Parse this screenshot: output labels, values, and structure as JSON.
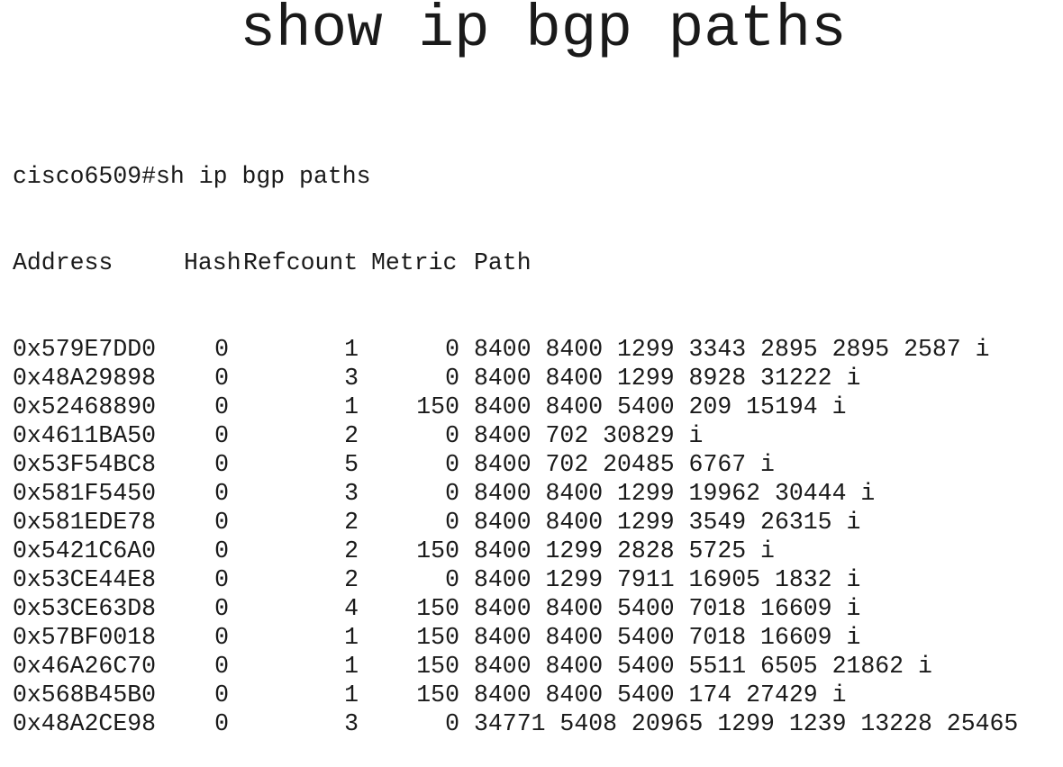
{
  "title": "show ip bgp paths",
  "terminal": {
    "prompt": "cisco6509#sh ip bgp paths",
    "headers": {
      "address": "Address",
      "hash": "Hash",
      "refcount": "Refcount",
      "metric": "Metric",
      "path": "Path"
    },
    "rows": [
      {
        "address": "0x579E7DD0",
        "hash": "0",
        "refcount": "1",
        "metric": "0",
        "path": "8400 8400 1299 3343 2895 2895 2587 i"
      },
      {
        "address": "0x48A29898",
        "hash": "0",
        "refcount": "3",
        "metric": "0",
        "path": "8400 8400 1299 8928 31222 i"
      },
      {
        "address": "0x52468890",
        "hash": "0",
        "refcount": "1",
        "metric": "150",
        "path": "8400 8400 5400 209 15194 i"
      },
      {
        "address": "0x4611BA50",
        "hash": "0",
        "refcount": "2",
        "metric": "0",
        "path": "8400 702 30829 i"
      },
      {
        "address": "0x53F54BC8",
        "hash": "0",
        "refcount": "5",
        "metric": "0",
        "path": "8400 702 20485 6767 i"
      },
      {
        "address": "0x581F5450",
        "hash": "0",
        "refcount": "3",
        "metric": "0",
        "path": "8400 8400 1299 19962 30444 i"
      },
      {
        "address": "0x581EDE78",
        "hash": "0",
        "refcount": "2",
        "metric": "0",
        "path": "8400 8400 1299 3549 26315 i"
      },
      {
        "address": "0x5421C6A0",
        "hash": "0",
        "refcount": "2",
        "metric": "150",
        "path": "8400 1299 2828 5725 i"
      },
      {
        "address": "0x53CE44E8",
        "hash": "0",
        "refcount": "2",
        "metric": "0",
        "path": "8400 1299 7911 16905 1832 i"
      },
      {
        "address": "0x53CE63D8",
        "hash": "0",
        "refcount": "4",
        "metric": "150",
        "path": "8400 8400 5400 7018 16609 i"
      },
      {
        "address": "0x57BF0018",
        "hash": "0",
        "refcount": "1",
        "metric": "150",
        "path": "8400 8400 5400 7018 16609 i"
      },
      {
        "address": "0x46A26C70",
        "hash": "0",
        "refcount": "1",
        "metric": "150",
        "path": "8400 8400 5400 5511 6505 21862 i"
      },
      {
        "address": "0x568B45B0",
        "hash": "0",
        "refcount": "1",
        "metric": "150",
        "path": "8400 8400 5400 174 27429 i"
      },
      {
        "address": "0x48A2CE98",
        "hash": "0",
        "refcount": "3",
        "metric": "0",
        "path": "34771 5408 20965 1299 1239 13228 25465"
      }
    ]
  }
}
